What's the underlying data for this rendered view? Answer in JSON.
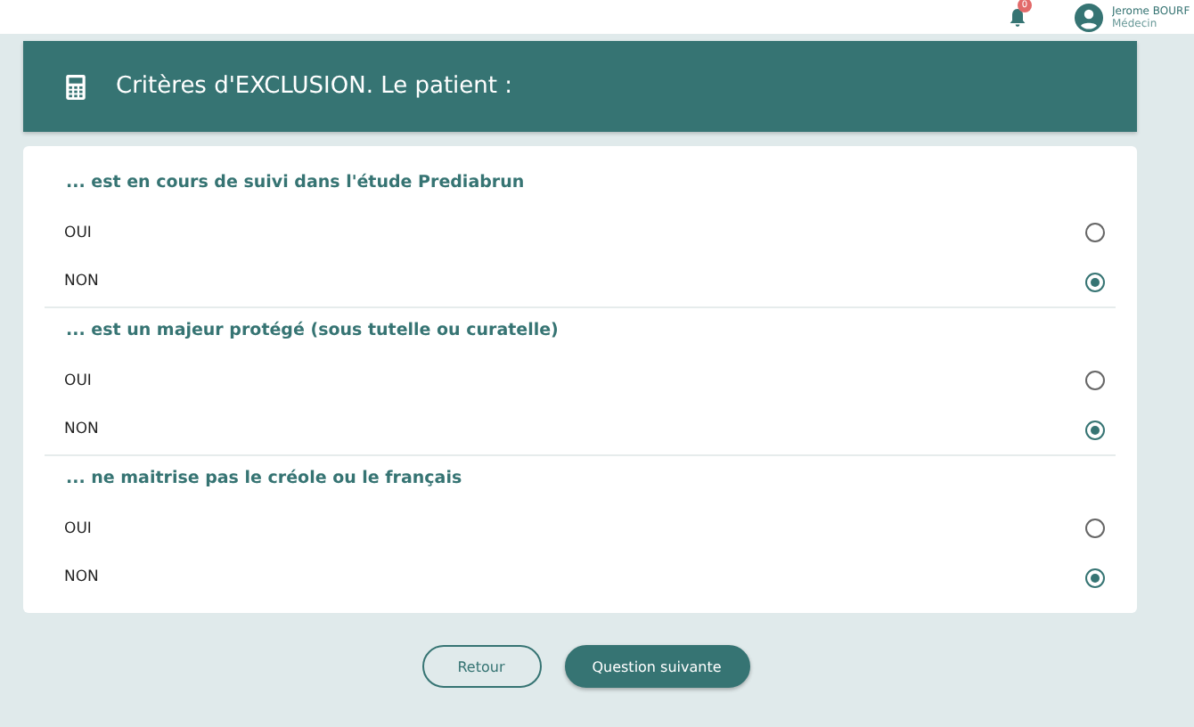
{
  "topbar": {
    "notifications": {
      "count": "0"
    },
    "user": {
      "name": "Jerome BOURF",
      "role": "Médecin"
    }
  },
  "header": {
    "title": "Critères d'EXCLUSION. Le patient :"
  },
  "questions": [
    {
      "text": "... est en cours de suivi dans l'étude Prediabrun",
      "options": [
        {
          "label": "OUI",
          "selected": false
        },
        {
          "label": "NON",
          "selected": true
        }
      ]
    },
    {
      "text": "... est un majeur protégé (sous tutelle ou curatelle)",
      "options": [
        {
          "label": "OUI",
          "selected": false
        },
        {
          "label": "NON",
          "selected": true
        }
      ]
    },
    {
      "text": "... ne maitrise pas le créole ou le français",
      "options": [
        {
          "label": "OUI",
          "selected": false
        },
        {
          "label": "NON",
          "selected": true
        }
      ]
    }
  ],
  "buttons": [
    {
      "label": "Retour",
      "kind": "secondary"
    },
    {
      "label": "Question suivante",
      "kind": "primary"
    }
  ]
}
